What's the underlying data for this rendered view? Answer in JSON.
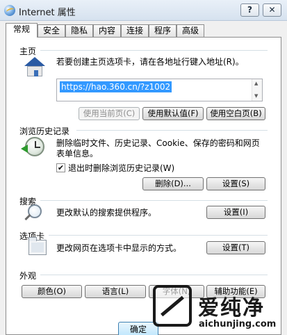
{
  "window": {
    "title": "Internet 属性",
    "help_label": "?",
    "close_label": "✕"
  },
  "tabs": [
    {
      "label": "常规",
      "active": true
    },
    {
      "label": "安全"
    },
    {
      "label": "隐私"
    },
    {
      "label": "内容"
    },
    {
      "label": "连接"
    },
    {
      "label": "程序"
    },
    {
      "label": "高级"
    }
  ],
  "homepage": {
    "heading": "主页",
    "description": "若要创建主页选项卡，请在各地址行键入地址(R)。",
    "url_value": "https://hao.360.cn/?z1002",
    "use_current_label": "使用当前页(C)",
    "use_default_label": "使用默认值(F)",
    "use_blank_label": "使用空白页(B)"
  },
  "history": {
    "heading": "浏览历史记录",
    "description_line1": "删除临时文件、历史记录、Cookie、保存的密码和网页",
    "description_line2": "表单信息。",
    "checkbox_label": "退出时删除浏览历史记录(W)",
    "checkbox_checked": true,
    "delete_label": "删除(D)...",
    "settings_label": "设置(S)"
  },
  "search": {
    "heading": "搜索",
    "description": "更改默认的搜索提供程序。",
    "settings_label": "设置(I)"
  },
  "tabbed": {
    "heading": "选项卡",
    "description": "更改网页在选项卡中显示的方式。",
    "settings_label": "设置(T)"
  },
  "appearance": {
    "heading": "外观",
    "colors_label": "颜色(O)",
    "languages_label": "语言(L)",
    "fonts_label": "字体(N)",
    "accessibility_label": "辅助功能(E)"
  },
  "footer": {
    "ok_label": "确定"
  },
  "watermark": {
    "brand": "爱纯净",
    "site": "aichunjing.com"
  },
  "colors": {
    "accent": "#3399ff",
    "titlebar": "#dbe6f2",
    "panel": "#ffffff"
  }
}
